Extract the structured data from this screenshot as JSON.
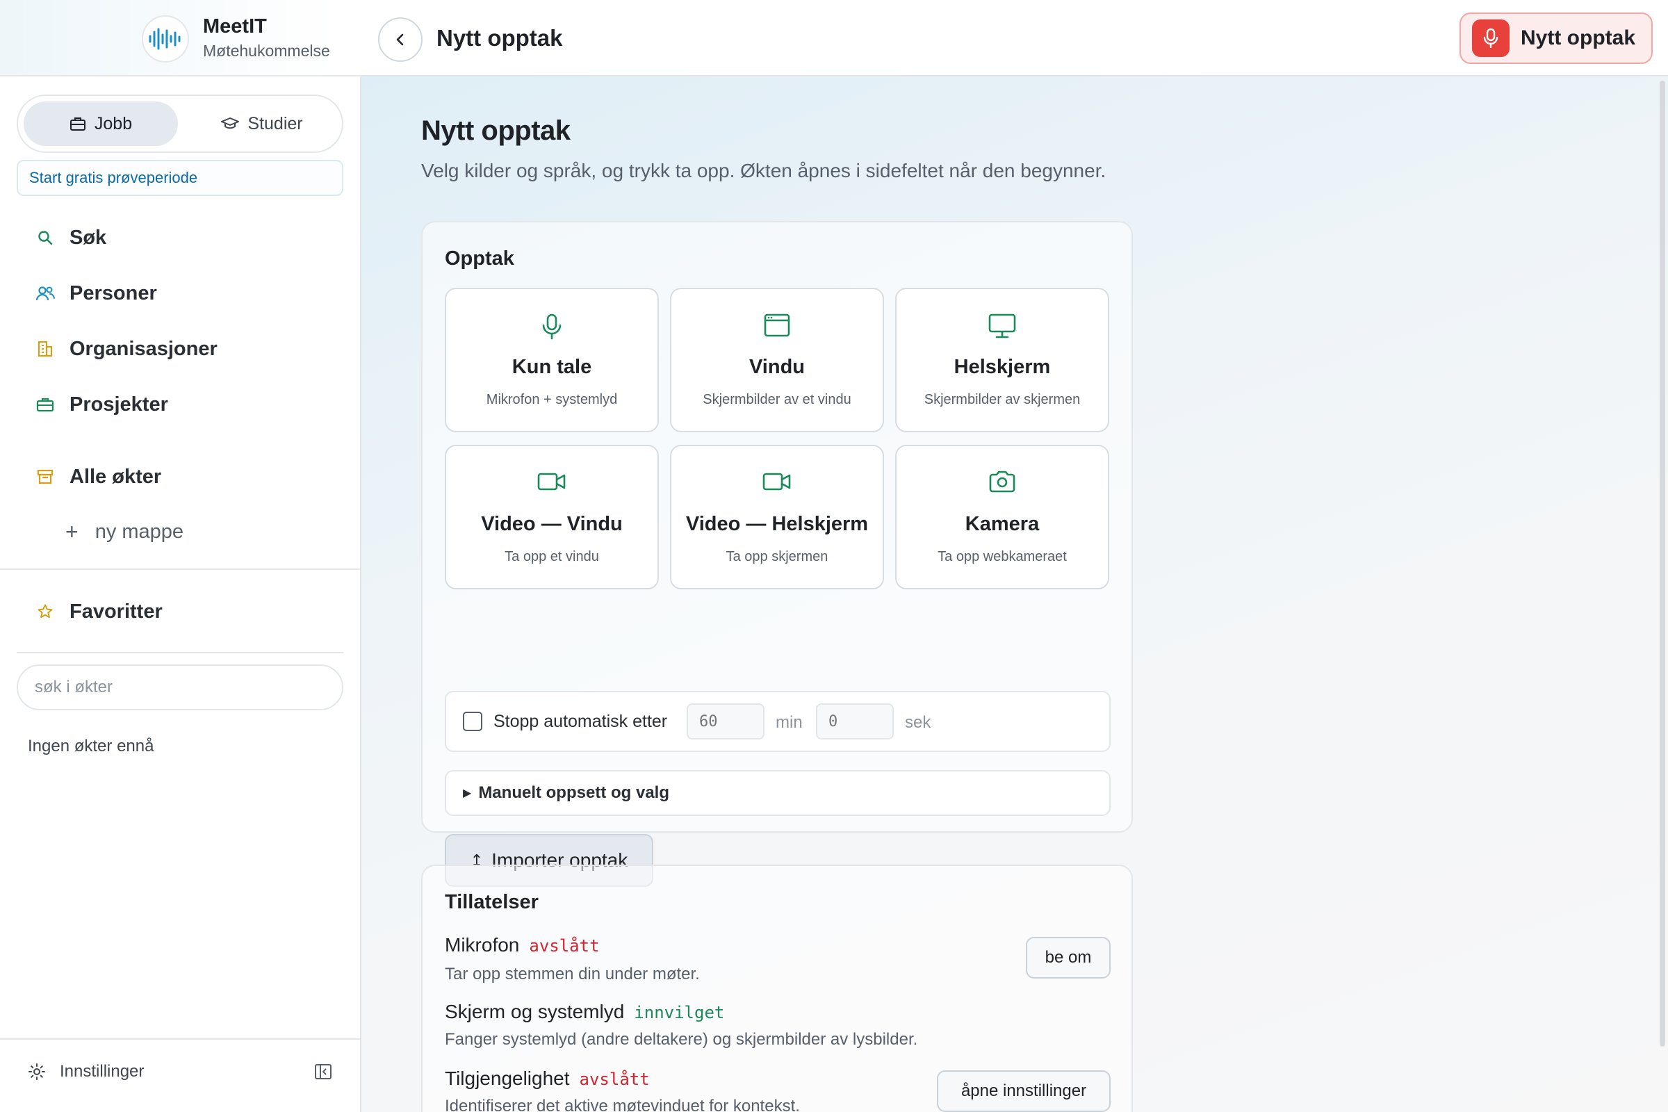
{
  "app": {
    "name": "MeetIT",
    "subtitle": "Møtehukommelse",
    "page_title": "Nytt opptak",
    "record_button": "Nytt opptak"
  },
  "sidebar": {
    "segments": {
      "work": "Jobb",
      "study": "Studier"
    },
    "trial": "Start gratis prøveperiode",
    "nav": {
      "search": "Søk",
      "people": "Personer",
      "orgs": "Organisasjoner",
      "projects": "Prosjekter",
      "all_sessions": "Alle økter",
      "new_folder": "ny mappe",
      "favorites": "Favoritter"
    },
    "search_placeholder": "søk i økter",
    "empty": "Ingen økter ennå",
    "settings": "Innstillinger"
  },
  "main": {
    "title": "Nytt opptak",
    "lead": "Velg kilder og språk, og trykk ta opp. Økten åpnes i sidefeltet når den begynner.",
    "recording": {
      "title": "Opptak",
      "tiles": [
        {
          "name": "Kun tale",
          "desc": "Mikrofon + systemlyd",
          "icon": "microphone-icon"
        },
        {
          "name": "Vindu",
          "desc": "Skjermbilder av et vindu",
          "icon": "window-icon"
        },
        {
          "name": "Helskjerm",
          "desc": "Skjermbilder av skjermen",
          "icon": "monitor-icon"
        },
        {
          "name": "Video — Vindu",
          "desc": "Ta opp et vindu",
          "icon": "video-icon"
        },
        {
          "name": "Video — Helskjerm",
          "desc": "Ta opp skjermen",
          "icon": "video-icon"
        },
        {
          "name": "Kamera",
          "desc": "Ta opp webkameraet",
          "icon": "camera-icon"
        }
      ],
      "autostop": {
        "label": "Stopp automatisk etter",
        "minutes": "60",
        "min_unit": "min",
        "seconds": "0",
        "sec_unit": "sek"
      },
      "manual": "Manuelt oppsett og valg",
      "import": "Importer opptak",
      "import_icon": "↥"
    },
    "permissions": {
      "title": "Tillatelser",
      "items": [
        {
          "name": "Mikrofon",
          "status": "avslått",
          "desc": "Tar opp stemmen din under møter.",
          "action": "be om"
        },
        {
          "name": "Skjerm og systemlyd",
          "status": "innvilget",
          "desc": "Fanger systemlyd (andre deltakere) og skjermbilder av lysbilder.",
          "action": ""
        },
        {
          "name": "Tilgjengelighet",
          "status": "avslått",
          "desc": "Identifiserer det aktive møtevinduet for kontekst.",
          "action": "åpne innstillinger"
        }
      ]
    }
  },
  "colors": {
    "accent_green": "#1a8a5a",
    "denied": "#d1242f",
    "granted": "#1a8a5a",
    "record_red": "#e8403b",
    "link_blue": "#0b6aa8"
  }
}
